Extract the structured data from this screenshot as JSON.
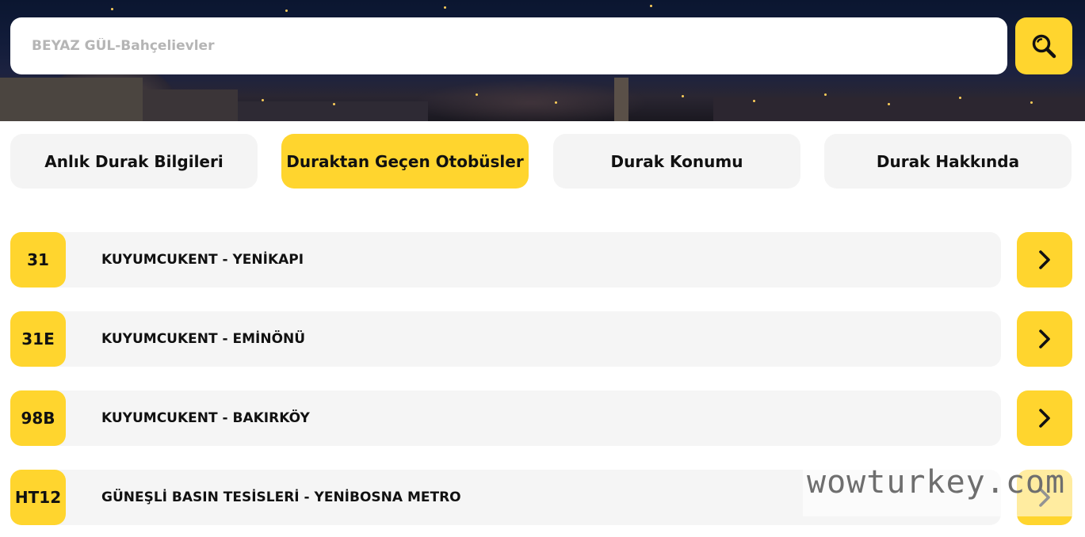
{
  "search": {
    "placeholder": "BEYAZ GÜL-Bahçelievler",
    "button_icon": "search-icon"
  },
  "tabs": [
    {
      "label": "Anlık Durak Bilgileri",
      "active": false
    },
    {
      "label": "Duraktan Geçen Otobüsler",
      "active": true
    },
    {
      "label": "Durak Konumu",
      "active": false
    },
    {
      "label": "Durak Hakkında",
      "active": false
    }
  ],
  "routes": [
    {
      "code": "31",
      "name": "KUYUMCUKENT - YENİKAPI"
    },
    {
      "code": "31E",
      "name": "KUYUMCUKENT - EMİNÖNÜ"
    },
    {
      "code": "98B",
      "name": "KUYUMCUKENT - BAKIRKÖY"
    },
    {
      "code": "HT12",
      "name": "GÜNEŞLİ BASIN TESİSLERİ - YENİBOSNA METRO"
    }
  ],
  "watermark": {
    "text": "wowturkey.com"
  },
  "colors": {
    "accent": "#ffd52e",
    "tab_bg": "#f4f4f4",
    "row_bg": "#f5f5f5",
    "text": "#111111"
  }
}
